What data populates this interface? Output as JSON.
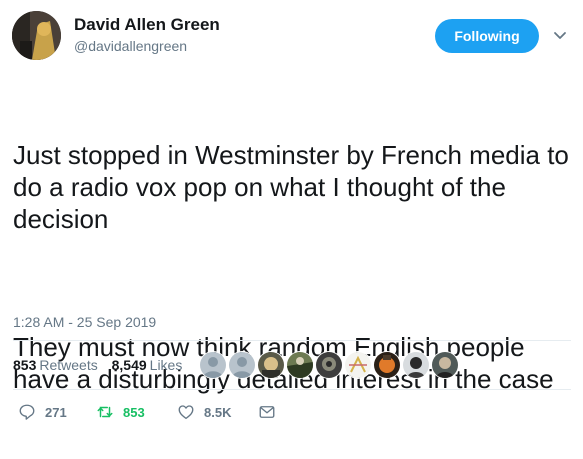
{
  "author": {
    "name": "David Allen Green",
    "handle": "@davidallengreen",
    "avatar_icon": "profile-photo",
    "follow_label": "Following"
  },
  "tweet": {
    "paragraphs": [
      "Just stopped in Westminster by French media to do a radio vox pop on what I thought of the decision",
      "They must now think random English people have a disturbingly detailed interest in the case"
    ],
    "timestamp": "1:28 AM - 25 Sep 2019"
  },
  "stats": {
    "retweets_count": "853",
    "retweets_label": "Retweets",
    "likes_count": "8,549",
    "likes_label": "Likes"
  },
  "liker_avatars": [
    "default-avatar",
    "default-avatar",
    "photo-avatar",
    "photo-avatar",
    "photo-avatar",
    "photo-avatar",
    "photo-avatar",
    "photo-avatar",
    "photo-avatar",
    "photo-avatar"
  ],
  "actions": {
    "reply_count": "271",
    "retweet_count": "853",
    "like_count": "8.5K"
  },
  "colors": {
    "accent": "#1da1f2",
    "retweet_green": "#17bf63",
    "secondary_text": "#657786",
    "primary_text": "#14171a",
    "divider": "#e6ecf0"
  }
}
